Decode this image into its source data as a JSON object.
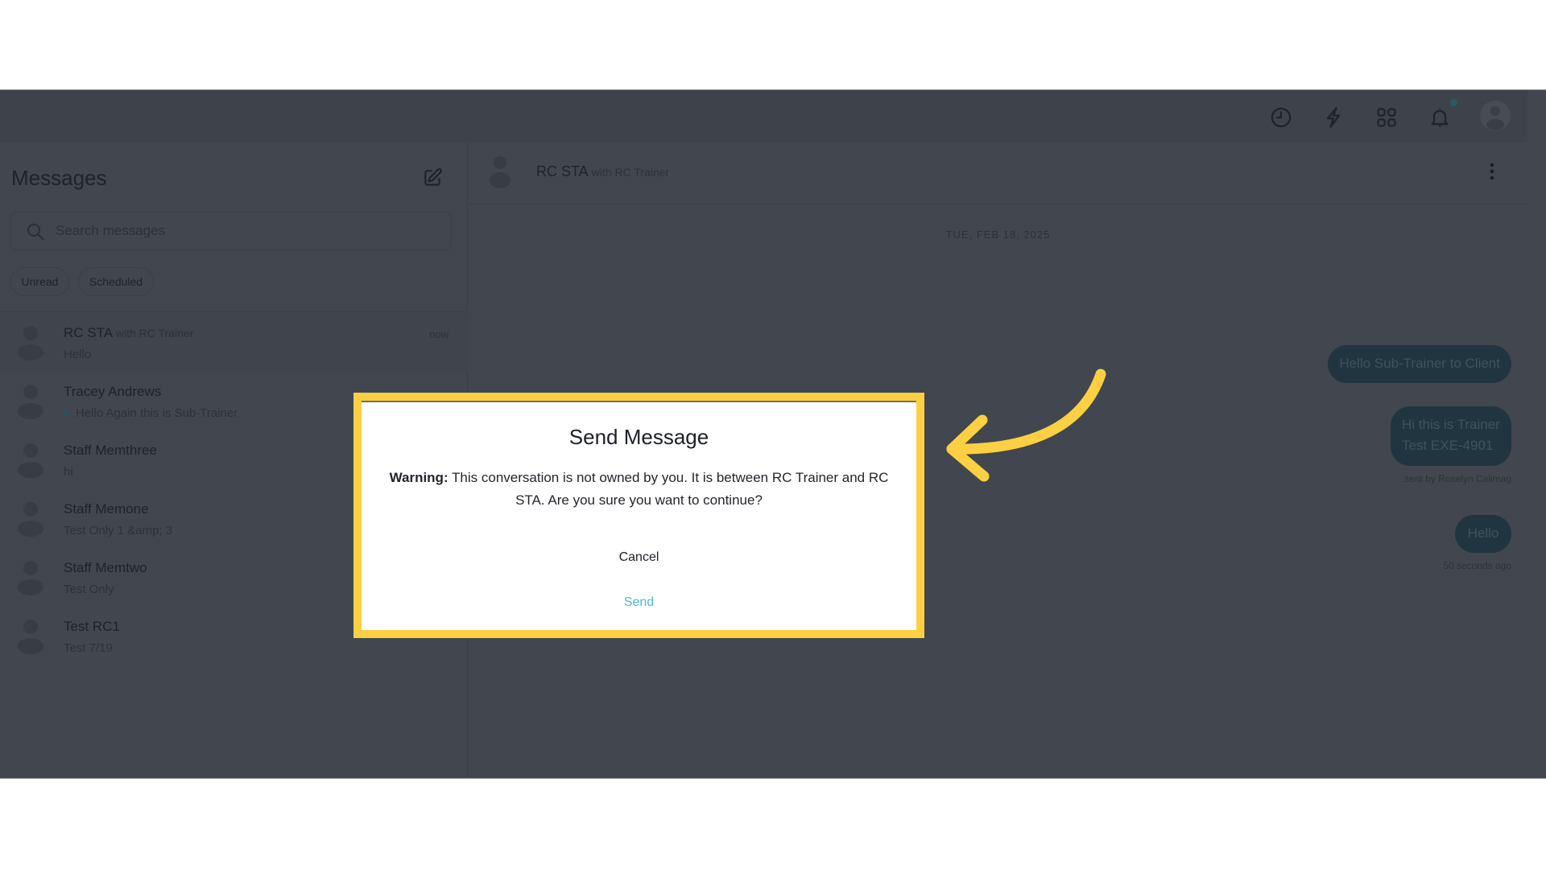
{
  "topbar": {
    "icons": [
      "history-clock-icon",
      "lightning-bolt-icon",
      "apps-grid-icon",
      "notification-bell-icon",
      "user-avatar-icon"
    ],
    "has_notification": true
  },
  "sidebar": {
    "title": "Messages",
    "compose_icon": "compose-icon",
    "search": {
      "placeholder": "Search messages",
      "value": ""
    },
    "filters": [
      {
        "label": "Unread"
      },
      {
        "label": "Scheduled"
      }
    ],
    "conversations": [
      {
        "name": "RC STA",
        "with": "with RC Trainer",
        "preview": "Hello",
        "time": "now",
        "active": true,
        "unread": false
      },
      {
        "name": "Tracey Andrews",
        "with": "",
        "preview": "Hello Again this is Sub-Trainer",
        "time": "",
        "active": false,
        "unread": true
      },
      {
        "name": "Staff Memthree",
        "with": "",
        "preview": "hi",
        "time": "",
        "active": false,
        "unread": false
      },
      {
        "name": "Staff Memone",
        "with": "",
        "preview": "Test Only 1 &amp; 3",
        "time": "",
        "active": false,
        "unread": false
      },
      {
        "name": "Staff Memtwo",
        "with": "",
        "preview": "Test Only",
        "time": "",
        "active": false,
        "unread": false
      },
      {
        "name": "Test RC1",
        "with": "",
        "preview": "Test 7/19",
        "time": "",
        "active": false,
        "unread": false
      }
    ]
  },
  "chat": {
    "title": "RC STA",
    "with": "with RC Trainer",
    "date_label": "TUE, FEB 18, 2025",
    "messages": [
      {
        "text": "Hello Sub-Trainer to Client",
        "meta": ""
      },
      {
        "text_line1": "Hi this is Trainer",
        "text_line2": "Test EXE-4901",
        "meta": "sent by Roselyn Calimag"
      },
      {
        "text": "Hello",
        "meta": "50 seconds ago"
      }
    ]
  },
  "modal": {
    "title": "Send Message",
    "warning_label": "Warning:",
    "warning_text": " This conversation is not owned by you. It is between RC Trainer and RC STA. Are you sure you want to continue?",
    "cancel_label": "Cancel",
    "send_label": "Send",
    "highlight_color": "#fdd043",
    "send_color": "#4fb7cf"
  },
  "annotation": {
    "arrow_color": "#fdd043",
    "arrow_points_to": "modal"
  }
}
